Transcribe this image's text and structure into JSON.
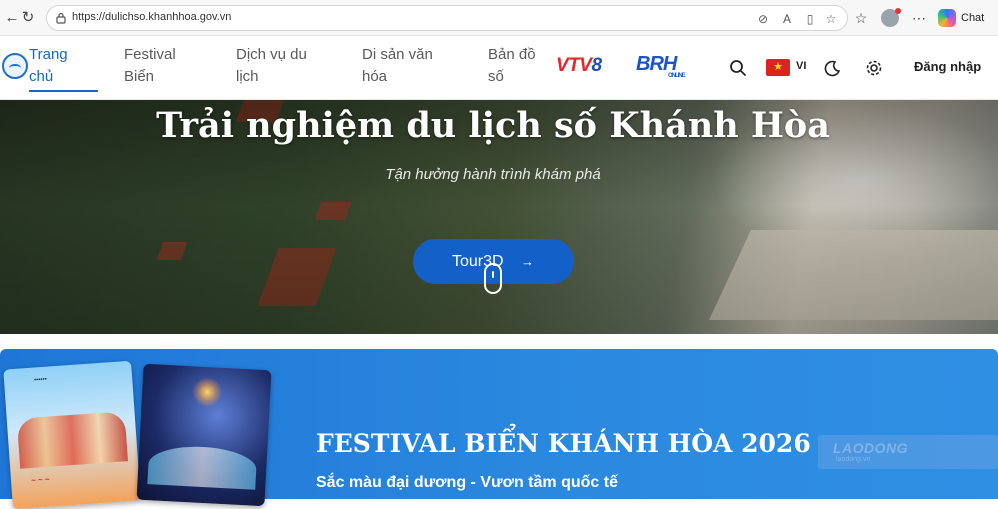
{
  "browser": {
    "url": "https://dulichso.khanhhoa.gov.vn",
    "chat_label": "Chat",
    "nav_icons": [
      "back-arrow-icon",
      "reload-icon"
    ],
    "toolbar_icons": [
      "tracking-prevention-icon",
      "read-aloud-icon",
      "reader-mode-icon",
      "favorite-star-icon",
      "favorites-list-icon",
      "profile-icon",
      "more-icon",
      "copilot-icon"
    ]
  },
  "header": {
    "nav": [
      {
        "line1": "Trang",
        "line2": "chủ",
        "active": true
      },
      {
        "line1": "Festival",
        "line2": "Biển",
        "active": false
      },
      {
        "line1": "Dịch vụ du",
        "line2": "lịch",
        "active": false
      },
      {
        "line1": "Di sản văn",
        "line2": "hóa",
        "active": false
      },
      {
        "line1": "Bản đồ",
        "line2": "số",
        "active": false
      }
    ],
    "partner1": {
      "part_a": "VTV",
      "part_b": "8"
    },
    "partner2": {
      "main": "BRH",
      "tag": "ONLINE"
    },
    "language": "VI",
    "login": "Đăng nhập",
    "accent": "#1268c9"
  },
  "hero": {
    "title": "Trải nghiệm du lịch số Khánh Hòa",
    "subtitle": "Tận hưởng hành trình khám phá",
    "button": "Tour3D",
    "button_arrow": "→",
    "button_color": "#1460c9"
  },
  "festival": {
    "title": "FESTIVAL BIỂN KHÁNH HÒA 2026",
    "subtitle": "Sắc màu đại dương - Vươn tầm quốc tế",
    "background": "#2b8ae0"
  },
  "watermark": {
    "name": "LAODONG",
    "site": "laodong.vn"
  }
}
